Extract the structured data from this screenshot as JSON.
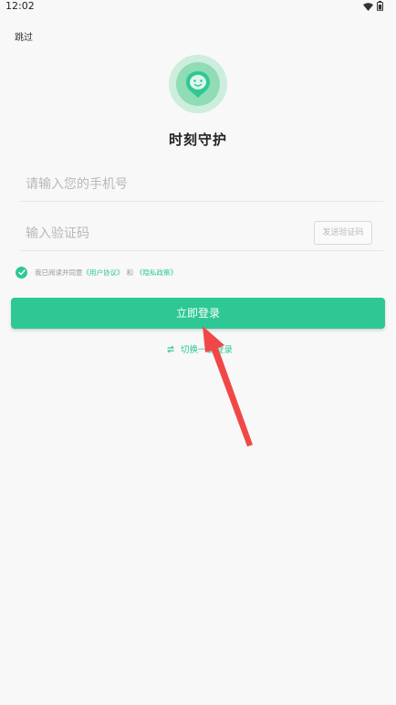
{
  "status_bar": {
    "time": "12:02"
  },
  "header": {
    "skip_label": "跳过"
  },
  "app": {
    "title": "时刻守护"
  },
  "form": {
    "phone_placeholder": "请输入您的手机号",
    "code_placeholder": "输入验证码",
    "send_code_label": "发送验证码"
  },
  "agreement": {
    "prefix": "我已阅读并同意",
    "user_agreement": "《用户协议》",
    "conjunction": "和",
    "privacy_policy": "《隐私政策》",
    "checked": true
  },
  "actions": {
    "login_label": "立即登录",
    "switch_label": "切换一键登录"
  },
  "colors": {
    "accent": "#2ec894",
    "annotation_arrow": "#f04848"
  }
}
